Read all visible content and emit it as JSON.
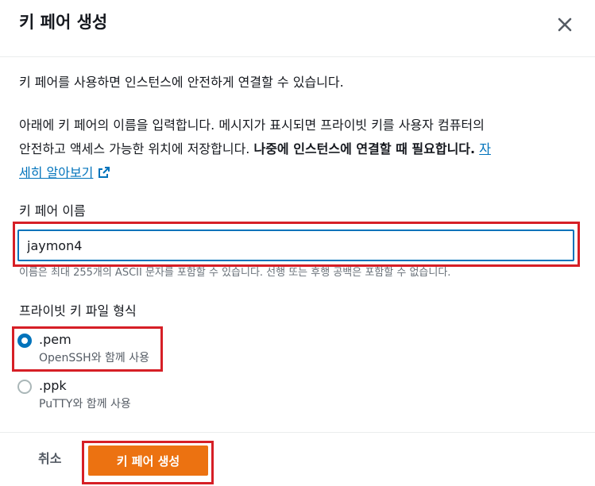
{
  "dialog": {
    "title": "키 페어 생성",
    "intro": "키 페어를 사용하면 인스턴스에 안전하게 연결할 수 있습니다.",
    "desc_part1": "아래에 키 페어의 이름을 입력합니다. 메시지가 표시되면 프라이빗 키를 사용자 컴퓨터의",
    "desc_part2": "안전하고 액세스 가능한 위치에 저장합니다. ",
    "desc_bold": "나중에 인스턴스에 연결할 때 필요합니다.",
    "learn_more_a": "자",
    "learn_more_b": "세히 알아보기"
  },
  "name_field": {
    "label": "키 페어 이름",
    "value": "jaymon4",
    "hint": "이름은 최대 255개의 ASCII 문자를 포함할 수 있습니다. 선행 또는 후행 공백은 포함할 수 없습니다."
  },
  "format": {
    "label": "프라이빗 키 파일 형식",
    "options": [
      {
        "title": ".pem",
        "subtitle": "OpenSSH와 함께 사용",
        "selected": true
      },
      {
        "title": ".ppk",
        "subtitle": "PuTTY와 함께 사용",
        "selected": false
      }
    ]
  },
  "footer": {
    "cancel_label": "취소",
    "create_label": "키 페어 생성"
  },
  "colors": {
    "accent": "#0073bb",
    "primary_button": "#ec7211",
    "highlight": "#d61f26"
  },
  "icons": {
    "close": "close-icon",
    "external_link": "external-link-icon"
  }
}
